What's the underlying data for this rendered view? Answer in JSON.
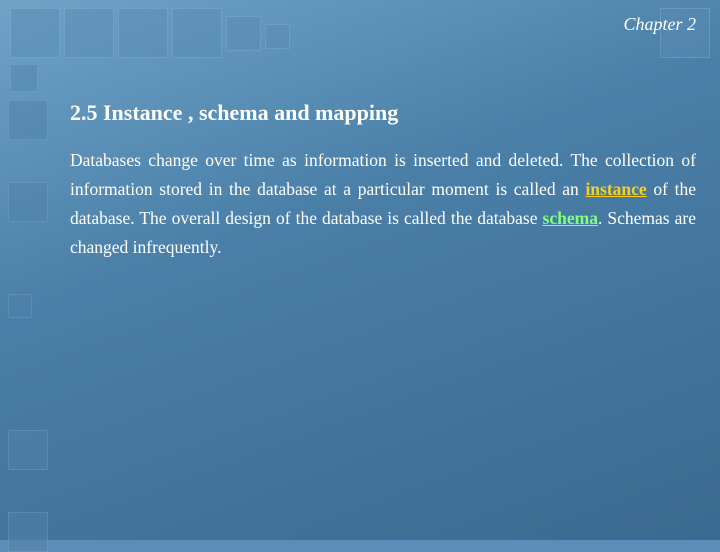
{
  "slide": {
    "chapter_label": "Chapter 2",
    "section_title": "2.5 Instance , schema and mapping",
    "body_text_1": "Databases change over time as information is inserted and deleted. The collection of information stored in the database at a particular moment is called an ",
    "highlight_instance": "instance",
    "body_text_2": " of the database. The overall design of the database is called the database ",
    "highlight_schema": "schema",
    "body_text_3": ". Schemas are changed infrequently."
  },
  "decorative": {
    "top_squares": [
      {
        "size": "lg"
      },
      {
        "size": "lg"
      },
      {
        "size": "lg"
      },
      {
        "size": "lg"
      },
      {
        "size": "md"
      },
      {
        "size": "sm"
      },
      {
        "size": "lg"
      }
    ]
  }
}
